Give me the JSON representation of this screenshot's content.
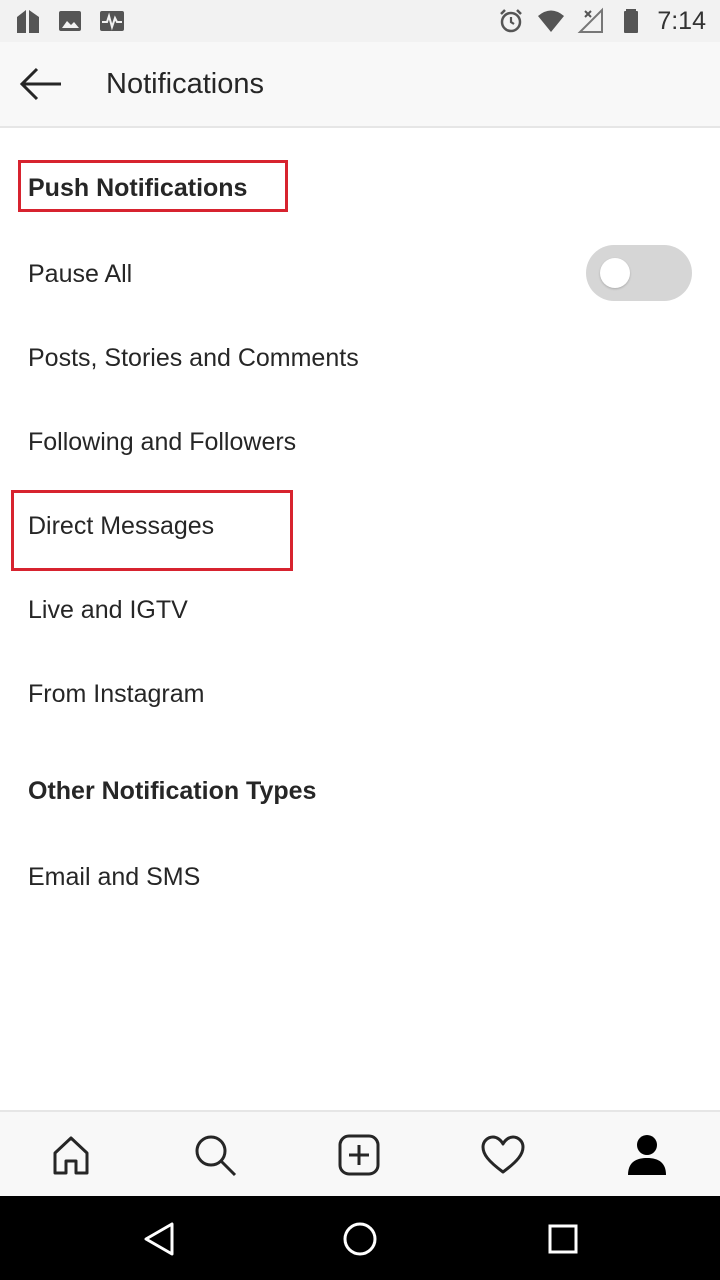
{
  "status_bar": {
    "time": "7:14",
    "left_icons": [
      "app-icon",
      "image-icon",
      "activity-icon"
    ],
    "right_icons": [
      "alarm-icon",
      "wifi-icon",
      "no-signal-icon",
      "battery-icon"
    ]
  },
  "header": {
    "title": "Notifications",
    "back_icon": "arrow-left-icon"
  },
  "push_section": {
    "title": "Push Notifications",
    "items": [
      {
        "label": "Pause All",
        "toggle_on": false
      },
      {
        "label": "Posts, Stories and Comments"
      },
      {
        "label": "Following and Followers"
      },
      {
        "label": "Direct Messages"
      },
      {
        "label": "Live and IGTV"
      },
      {
        "label": "From Instagram"
      }
    ]
  },
  "other_section": {
    "title": "Other Notification Types",
    "items": [
      {
        "label": "Email and SMS"
      }
    ]
  },
  "tab_bar": {
    "tabs": [
      "home-icon",
      "search-icon",
      "add-post-icon",
      "heart-icon",
      "profile-icon"
    ]
  },
  "nav_bar": {
    "buttons": [
      "back-triangle-icon",
      "home-circle-icon",
      "recents-square-icon"
    ]
  },
  "colors": {
    "highlight": "#d7232f",
    "toggle_off": "#d6d6d6",
    "text": "#262626"
  }
}
